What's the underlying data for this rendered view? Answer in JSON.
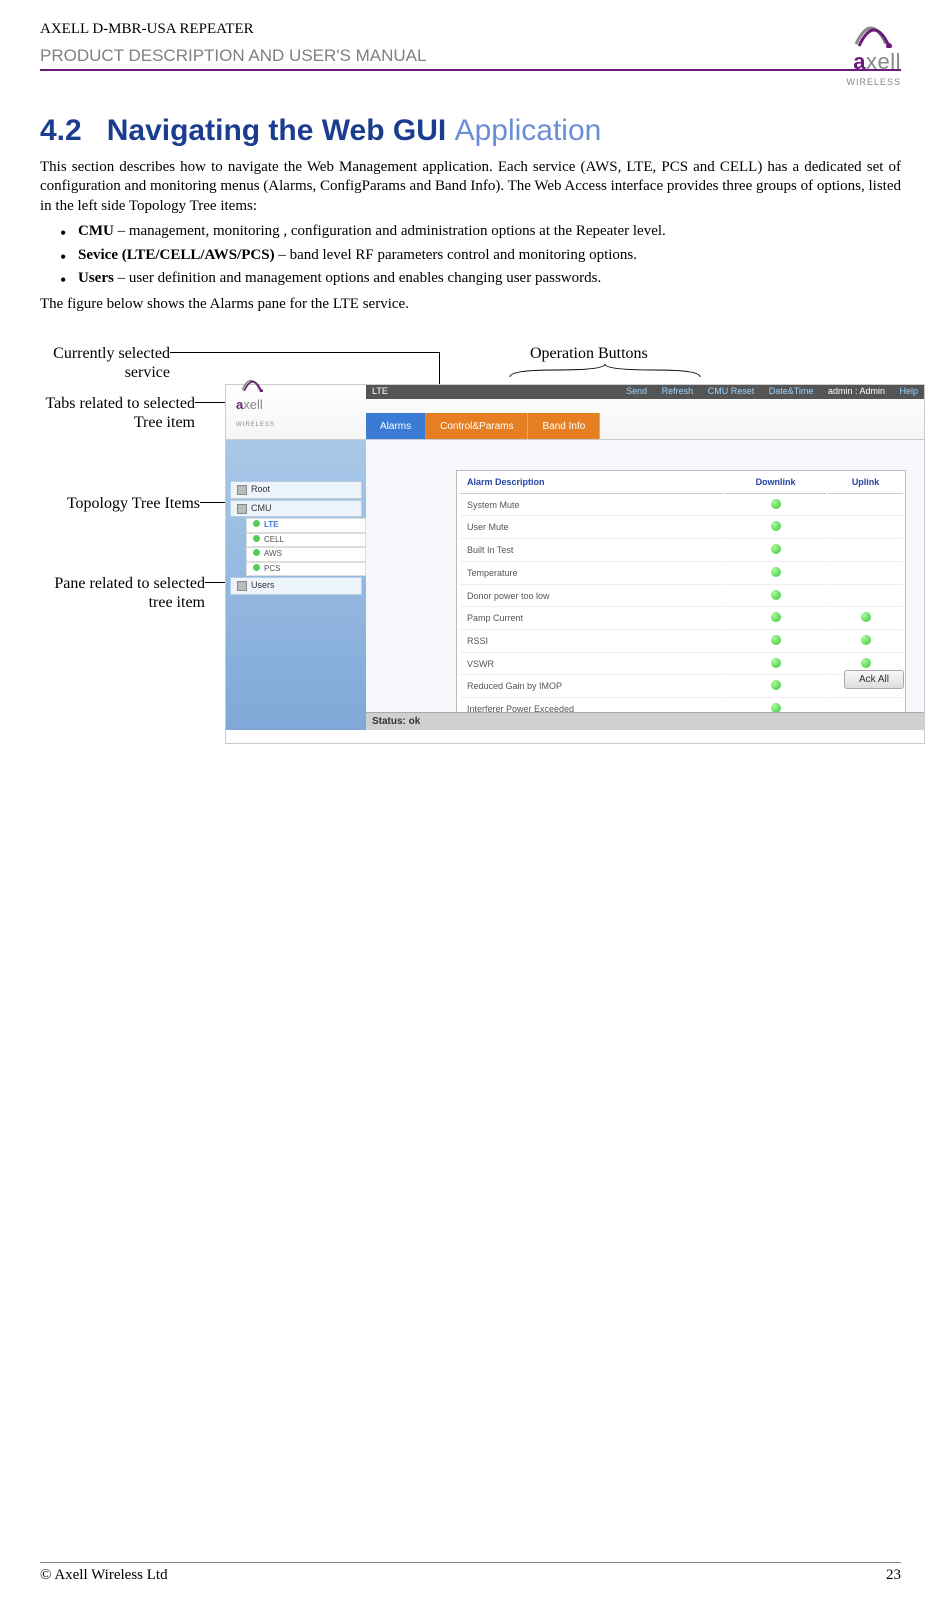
{
  "header": {
    "product": "AXELL D-MBR-USA REPEATER",
    "subtitle": "PRODUCT DESCRIPTION AND USER'S MANUAL",
    "logo_main": "axell",
    "logo_sub": "WIRELESS"
  },
  "section": {
    "number": "4.2",
    "title_bold": "Navigating the Web GUI",
    "title_light": "Application",
    "intro": "This section describes how to navigate the Web Management application. Each service (AWS, LTE, PCS and CELL) has a dedicated set of configuration and monitoring menus (Alarms, ConfigParams and Band Info). The Web Access interface provides three groups of options, listed in the left side Topology Tree items:",
    "bullets": [
      {
        "bold": "CMU",
        "rest": " –  management, monitoring , configuration and administration options at the Repeater level."
      },
      {
        "bold": "Sevice (LTE/CELL/AWS/PCS)",
        "rest": "  – band level RF parameters control and monitoring options."
      },
      {
        "bold": "Users",
        "rest": " – user definition and management options and enables changing user passwords."
      }
    ],
    "post_bullets": "The figure below shows the Alarms pane for the LTE service."
  },
  "annotations": {
    "curr_sel": "Currently selected service",
    "tabs_rel": "Tabs related to selected Tree item",
    "topo_tree": "Topology Tree Items",
    "pane_rel": "Pane related to selected tree item",
    "op_buttons": "Operation Buttons"
  },
  "screenshot": {
    "title_left": "LTE",
    "top_links": {
      "send": "Send",
      "refresh": "Refresh",
      "cmu_reset": "CMU Reset",
      "datetime": "Date&Time",
      "admin": "admin : Admin",
      "help": "Help"
    },
    "tabs": {
      "alarms": "Alarms",
      "control": "Control&Params",
      "band": "Band Info"
    },
    "tree": {
      "root": "Root",
      "cmu": "CMU",
      "lte": "LTE",
      "cell": "CELL",
      "aws": "AWS",
      "pcs": "PCS",
      "users": "Users"
    },
    "table": {
      "headers": {
        "desc": "Alarm Description",
        "dl": "Downlink",
        "ul": "Uplink"
      },
      "rows": [
        {
          "name": "System Mute",
          "dl": true,
          "ul": false
        },
        {
          "name": "User Mute",
          "dl": true,
          "ul": false
        },
        {
          "name": "Built In Test",
          "dl": true,
          "ul": false
        },
        {
          "name": "Temperature",
          "dl": true,
          "ul": false
        },
        {
          "name": "Donor power too low",
          "dl": true,
          "ul": false
        },
        {
          "name": "Pamp Current",
          "dl": true,
          "ul": true
        },
        {
          "name": "RSSI",
          "dl": true,
          "ul": true
        },
        {
          "name": "VSWR",
          "dl": true,
          "ul": true
        },
        {
          "name": "Reduced Gain by IMOP",
          "dl": true,
          "ul": false
        },
        {
          "name": "Interferer Power Exceeded",
          "dl": true,
          "ul": false
        }
      ]
    },
    "ack_button": "Ack All",
    "status": "Status: ok"
  },
  "footer": {
    "copyright": "© Axell Wireless Ltd",
    "page": "23"
  }
}
